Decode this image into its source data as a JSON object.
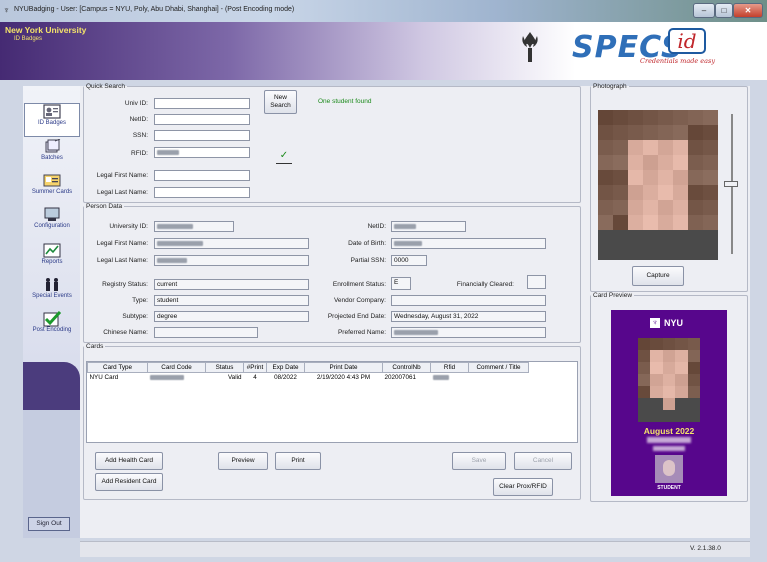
{
  "window": {
    "title": "NYUBadging - User:        [Campus = NYU, Poly, Abu Dhabi, Shanghai] - (Post Encoding mode)",
    "min": "–",
    "max": "□",
    "close": "✕"
  },
  "banner": {
    "university": "New York University",
    "subtitle": "ID Badges",
    "specs_logo": "SPECS",
    "specs_id": "id",
    "tagline": "Credentials made easy"
  },
  "sidebar": {
    "items": [
      {
        "label": "ID Badges",
        "icon": "id-badge-icon",
        "glyph": "🪪"
      },
      {
        "label": "Batches",
        "icon": "batches-icon",
        "glyph": "🗂"
      },
      {
        "label": "Summer Cards",
        "icon": "summer-cards-icon",
        "glyph": "🗃"
      },
      {
        "label": "Configuration",
        "icon": "configuration-icon",
        "glyph": "🖥"
      },
      {
        "label": "Reports",
        "icon": "reports-icon",
        "glyph": "📈"
      },
      {
        "label": "Special Events",
        "icon": "special-events-icon",
        "glyph": "👥"
      },
      {
        "label": "Post Encoding",
        "icon": "post-encoding-icon",
        "glyph": "✔"
      }
    ],
    "signout": "Sign Out"
  },
  "quick_search": {
    "legend": "Quick Search",
    "univ_id_label": "Univ ID:",
    "netid_label": "NetID:",
    "ssn_label": "SSN:",
    "rfid_label": "RFID:",
    "legal_first_label": "Legal First Name:",
    "legal_last_label": "Legal Last Name:",
    "new_search_line1": "New",
    "new_search_line2": "Search",
    "result": "One student found",
    "checkmark": "✓"
  },
  "person": {
    "legend": "Person Data",
    "university_id_label": "University ID:",
    "legal_first_label": "Legal First Name:",
    "legal_last_label": "Legal Last Name:",
    "registry_status_label": "Registry Status:",
    "registry_status": "current",
    "type_label": "Type:",
    "type": "student",
    "subtype_label": "Subtype:",
    "subtype": "degree",
    "chinese_name_label": "Chinese Name:",
    "netid_label": "NetID:",
    "dob_label": "Date of Birth:",
    "partial_ssn_label": "Partial SSN:",
    "partial_ssn": "0000",
    "enrollment_label": "Enrollment Status:",
    "enrollment": "E",
    "financially_label": "Financially Cleared:",
    "vendor_label": "Vendor Company:",
    "projected_end_label": "Projected End Date:",
    "projected_end": "Wednesday, August 31, 2022",
    "preferred_label": "Preferred Name:"
  },
  "cards": {
    "legend": "Cards",
    "columns": [
      "Card Type",
      "Card Code",
      "Status",
      "#Print",
      "Exp Date",
      "Print Date",
      "ControlNb",
      "Rfid",
      "Comment / Title"
    ],
    "rows": [
      {
        "card_type": "NYU Card",
        "status": "Valid",
        "prints": "4",
        "exp_date": "08/2022",
        "print_date": "2/19/2020 4:43 PM",
        "control_nb": "202007061"
      }
    ],
    "add_health": "Add Health Card",
    "add_resident": "Add Resident Card",
    "preview": "Preview",
    "print": "Print",
    "save": "Save",
    "cancel": "Cancel",
    "clear_prox": "Clear Prox/RFID"
  },
  "photo": {
    "legend": "Photograph",
    "capture": "Capture"
  },
  "card_preview": {
    "legend": "Card Preview",
    "brand": "NYU",
    "expiry": "August 2022",
    "role": "STUDENT"
  },
  "status": {
    "version": "V. 2.1.38.0"
  },
  "colors": {
    "nyu_purple": "#57068c",
    "banner_gold": "#f4e36a",
    "specs_blue": "#2f6fb8",
    "success_green": "#1c8a1c"
  }
}
